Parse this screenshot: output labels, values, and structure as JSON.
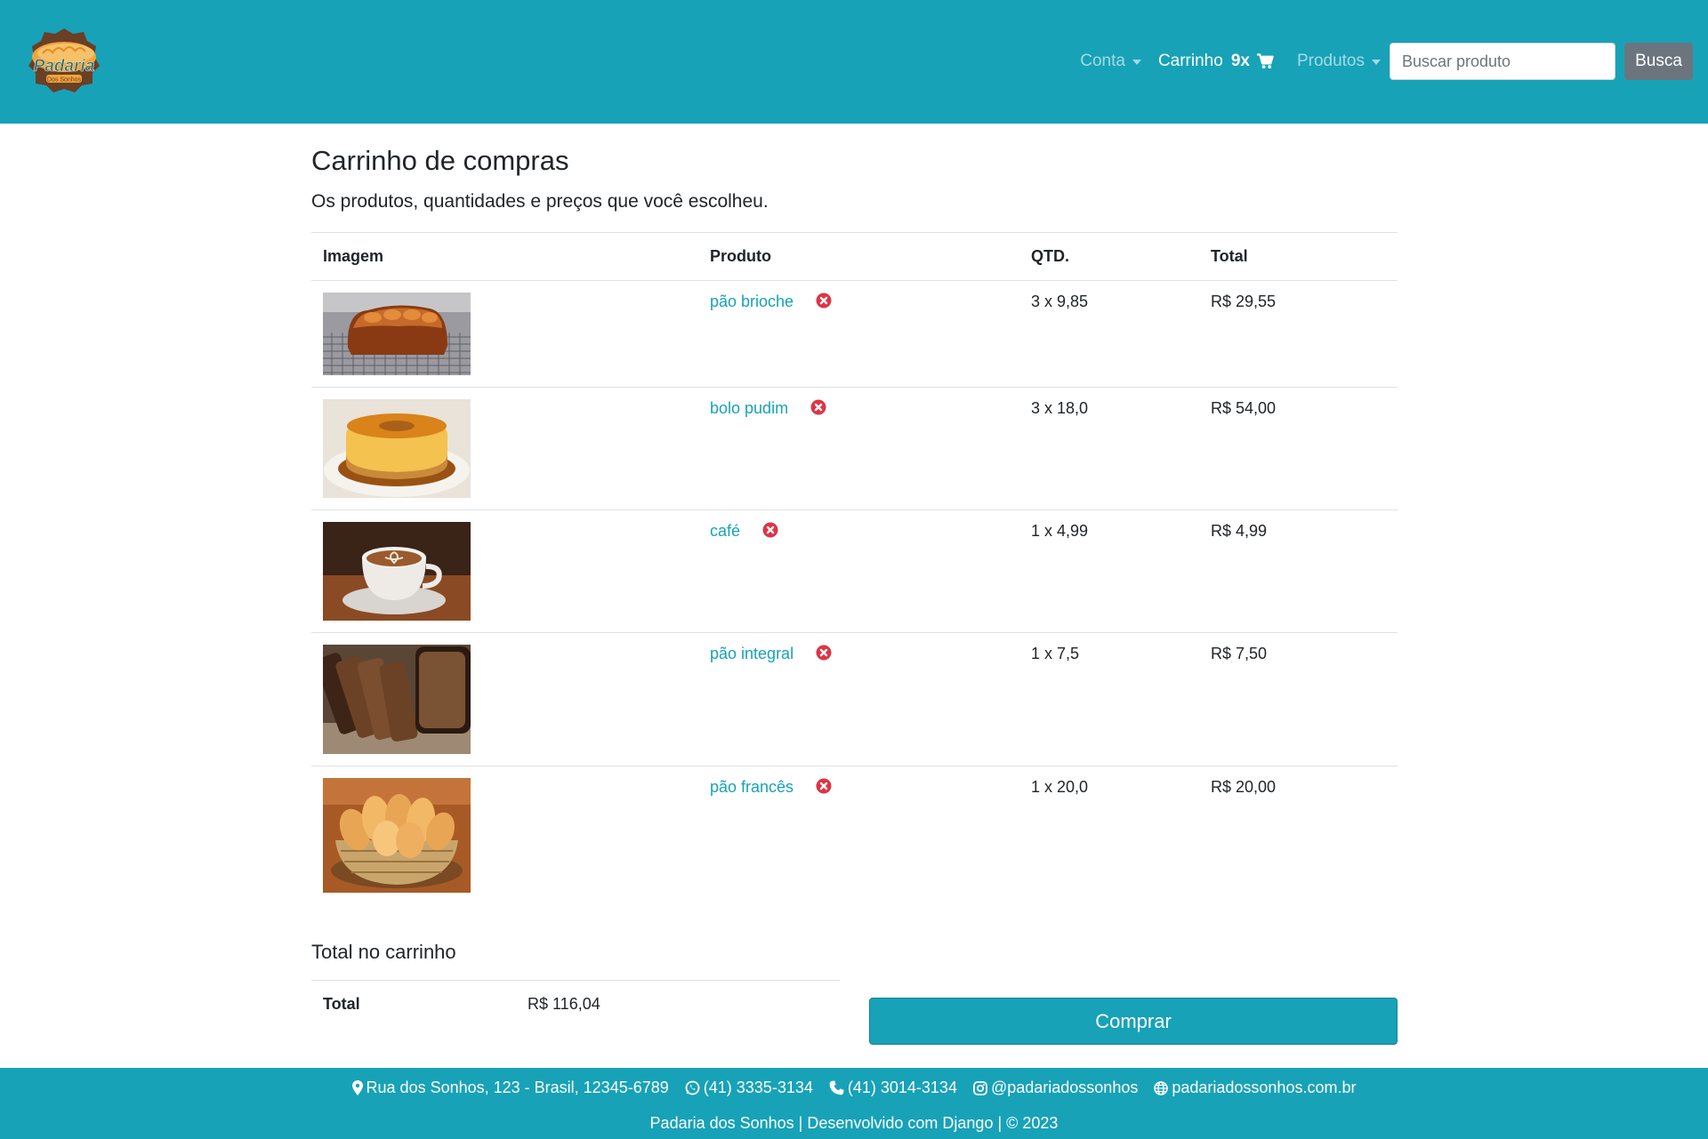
{
  "brand": {
    "logo_text": "Padaria",
    "logo_subtext": "Dos Sonhos",
    "color": "#17a2b8"
  },
  "nav": {
    "account_label": "Conta",
    "cart_label": "Carrinho",
    "cart_count": "9x",
    "products_label": "Produtos",
    "search_placeholder": "Buscar produto",
    "search_button": "Busca"
  },
  "page": {
    "title": "Carrinho de compras",
    "subtitle": "Os produtos, quantidades e preços que você escolheu."
  },
  "table": {
    "headers": [
      "Imagem",
      "Produto",
      "QTD.",
      "Total"
    ],
    "rows": [
      {
        "product": "pão brioche",
        "qty": "3 x 9,85",
        "total": "R$ 29,55",
        "image": "brioche-bread"
      },
      {
        "product": "bolo pudim",
        "qty": "3 x 18,0",
        "total": "R$ 54,00",
        "image": "flan-cake"
      },
      {
        "product": "café",
        "qty": "1 x 4,99",
        "total": "R$ 4,99",
        "image": "coffee-cup"
      },
      {
        "product": "pão integral",
        "qty": "1 x 7,5",
        "total": "R$ 7,50",
        "image": "wholegrain-bread"
      },
      {
        "product": "pão francês",
        "qty": "1 x 20,0",
        "total": "R$ 20,00",
        "image": "french-rolls-basket"
      }
    ]
  },
  "summary": {
    "title": "Total no carrinho",
    "total_label": "Total",
    "total_value": "R$ 116,04",
    "buy_button": "Comprar"
  },
  "footer": {
    "address": "Rua dos Sonhos, 123 - Brasil, 12345-6789",
    "whatsapp": "(41) 3335-3134",
    "phone": "(41) 3014-3134",
    "instagram": "@padariadossonhos",
    "website": "padariadossonhos.com.br",
    "credits": "Padaria dos Sonhos | Desenvolvido com Django | © 2023"
  }
}
